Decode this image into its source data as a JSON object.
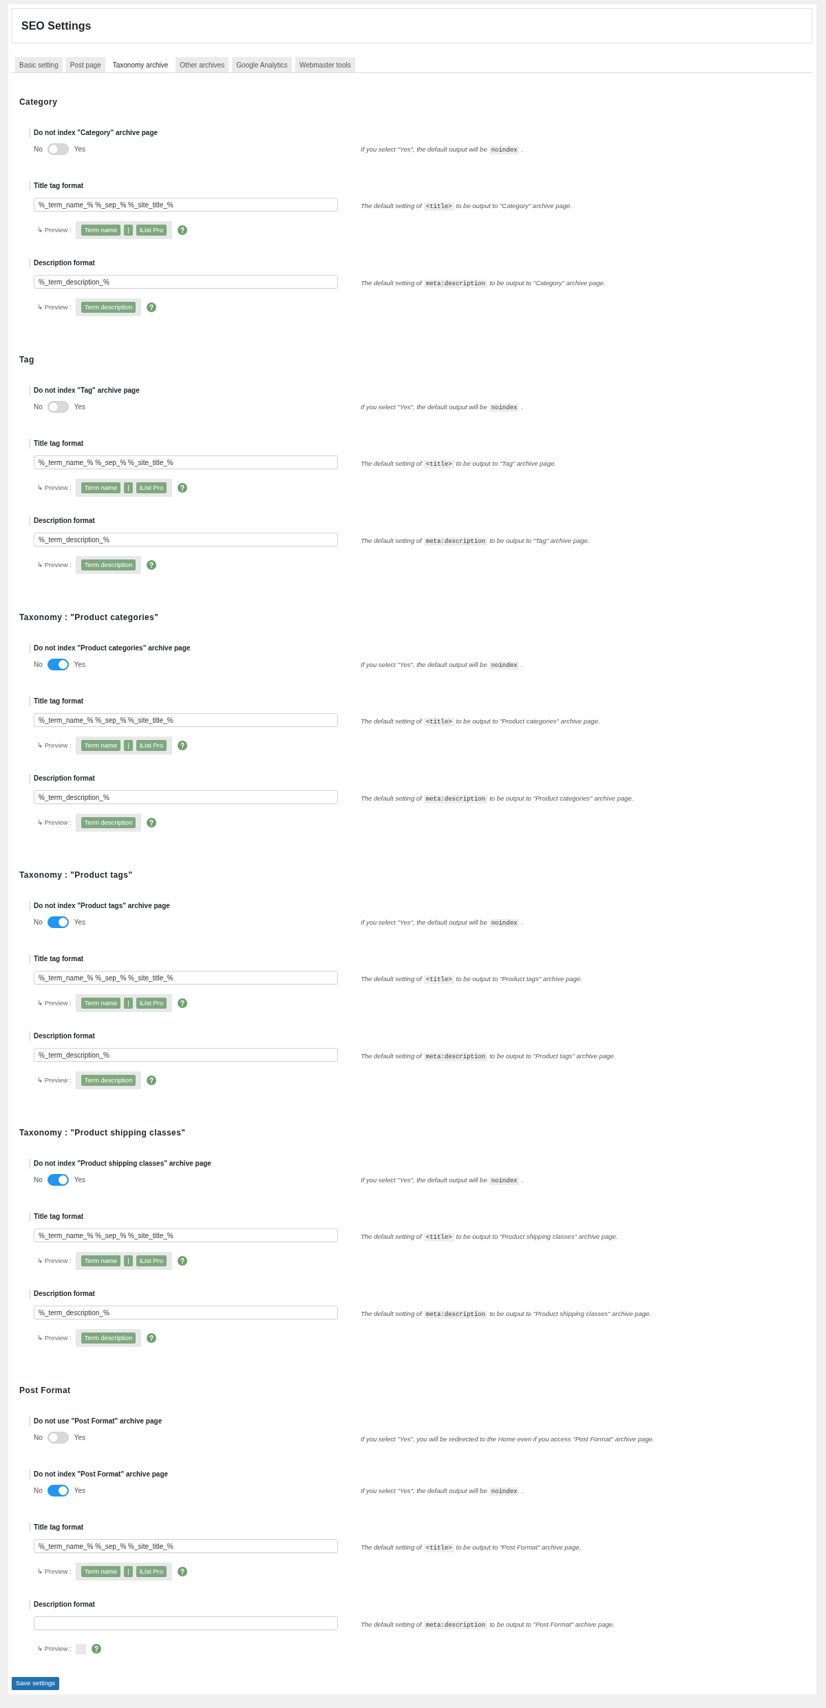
{
  "header": {
    "title": "SEO Settings"
  },
  "tabs": [
    {
      "label": "Basic setting",
      "selected": false
    },
    {
      "label": "Post page",
      "selected": false
    },
    {
      "label": "Taxonomy archive",
      "selected": true
    },
    {
      "label": "Other archives",
      "selected": false
    },
    {
      "label": "Google Analytics",
      "selected": false
    },
    {
      "label": "Webmaster tools",
      "selected": false
    }
  ],
  "sections": [
    {
      "title": "Category",
      "fields": [
        {
          "kind": "toggle",
          "label": "Do not index \"Category\" archive page",
          "off_label": "No",
          "on_label": "Yes",
          "on": false,
          "description": [
            {
              "kind": "text",
              "text": "If you select \"Yes\", the default output will be"
            },
            {
              "kind": "code",
              "text": "noindex"
            },
            {
              "kind": "text",
              "text": "."
            }
          ]
        },
        {
          "kind": "text",
          "label": "Title tag format",
          "value": "%_term_name_% %_sep_% %_site_title_%",
          "preview_label": "↳ Preview :",
          "preview": [
            "Term name",
            "|",
            "iList Pro"
          ],
          "description": [
            {
              "kind": "text",
              "text": "The default setting of"
            },
            {
              "kind": "code",
              "text": "<title>"
            },
            {
              "kind": "text",
              "text": "to be output to \"Category\" archive page."
            }
          ]
        },
        {
          "kind": "text",
          "label": "Description format",
          "value": "%_term_description_%",
          "preview_label": "↳ Preview :",
          "preview": [
            "Term description"
          ],
          "description": [
            {
              "kind": "text",
              "text": "The default setting of"
            },
            {
              "kind": "code",
              "text": "meta:description"
            },
            {
              "kind": "text",
              "text": "to be output to \"Category\" archive page."
            }
          ]
        }
      ]
    },
    {
      "title": "Tag",
      "fields": [
        {
          "kind": "toggle",
          "label": "Do not index \"Tag\" archive page",
          "off_label": "No",
          "on_label": "Yes",
          "on": false,
          "description": [
            {
              "kind": "text",
              "text": "If you select \"Yes\", the default output will be"
            },
            {
              "kind": "code",
              "text": "noindex"
            },
            {
              "kind": "text",
              "text": "."
            }
          ]
        },
        {
          "kind": "text",
          "label": "Title tag format",
          "value": "%_term_name_% %_sep_% %_site_title_%",
          "preview_label": "↳ Preview :",
          "preview": [
            "Term name",
            "|",
            "iList Pro"
          ],
          "description": [
            {
              "kind": "text",
              "text": "The default setting of"
            },
            {
              "kind": "code",
              "text": "<title>"
            },
            {
              "kind": "text",
              "text": "to be output to \"Tag\" archive page."
            }
          ]
        },
        {
          "kind": "text",
          "label": "Description format",
          "value": "%_term_description_%",
          "preview_label": "↳ Preview :",
          "preview": [
            "Term description"
          ],
          "description": [
            {
              "kind": "text",
              "text": "The default setting of"
            },
            {
              "kind": "code",
              "text": "meta:description"
            },
            {
              "kind": "text",
              "text": "to be output to \"Tag\" archive page."
            }
          ]
        }
      ]
    },
    {
      "title": "Taxonomy : \"Product categories\"",
      "fields": [
        {
          "kind": "toggle",
          "label": "Do not index \"Product categories\" archive page",
          "off_label": "No",
          "on_label": "Yes",
          "on": true,
          "description": [
            {
              "kind": "text",
              "text": "If you select \"Yes\", the default output will be"
            },
            {
              "kind": "code",
              "text": "noindex"
            },
            {
              "kind": "text",
              "text": "."
            }
          ]
        },
        {
          "kind": "text",
          "label": "Title tag format",
          "value": "%_term_name_% %_sep_% %_site_title_%",
          "preview_label": "↳ Preview :",
          "preview": [
            "Term name",
            "|",
            "iList Pro"
          ],
          "description": [
            {
              "kind": "text",
              "text": "The default setting of"
            },
            {
              "kind": "code",
              "text": "<title>"
            },
            {
              "kind": "text",
              "text": "to be output to \"Product categories\" archive page."
            }
          ]
        },
        {
          "kind": "text",
          "label": "Description format",
          "value": "%_term_description_%",
          "preview_label": "↳ Preview :",
          "preview": [
            "Term description"
          ],
          "description": [
            {
              "kind": "text",
              "text": "The default setting of"
            },
            {
              "kind": "code",
              "text": "meta:description"
            },
            {
              "kind": "text",
              "text": "to be output to \"Product categories\" archive page."
            }
          ]
        }
      ]
    },
    {
      "title": "Taxonomy : \"Product tags\"",
      "fields": [
        {
          "kind": "toggle",
          "label": "Do not index \"Product tags\" archive page",
          "off_label": "No",
          "on_label": "Yes",
          "on": true,
          "description": [
            {
              "kind": "text",
              "text": "If you select \"Yes\", the default output will be"
            },
            {
              "kind": "code",
              "text": "noindex"
            },
            {
              "kind": "text",
              "text": "."
            }
          ]
        },
        {
          "kind": "text",
          "label": "Title tag format",
          "value": "%_term_name_% %_sep_% %_site_title_%",
          "preview_label": "↳ Preview :",
          "preview": [
            "Term name",
            "|",
            "iList Pro"
          ],
          "description": [
            {
              "kind": "text",
              "text": "The default setting of"
            },
            {
              "kind": "code",
              "text": "<title>"
            },
            {
              "kind": "text",
              "text": "to be output to \"Product tags\" archive page."
            }
          ]
        },
        {
          "kind": "text",
          "label": "Description format",
          "value": "%_term_description_%",
          "preview_label": "↳ Preview :",
          "preview": [
            "Term description"
          ],
          "description": [
            {
              "kind": "text",
              "text": "The default setting of"
            },
            {
              "kind": "code",
              "text": "meta:description"
            },
            {
              "kind": "text",
              "text": "to be output to \"Product tags\" archive page."
            }
          ]
        }
      ]
    },
    {
      "title": "Taxonomy : \"Product shipping classes\"",
      "fields": [
        {
          "kind": "toggle",
          "label": "Do not index \"Product shipping classes\" archive page",
          "off_label": "No",
          "on_label": "Yes",
          "on": true,
          "description": [
            {
              "kind": "text",
              "text": "If you select \"Yes\", the default output will be"
            },
            {
              "kind": "code",
              "text": "noindex"
            },
            {
              "kind": "text",
              "text": "."
            }
          ]
        },
        {
          "kind": "text",
          "label": "Title tag format",
          "value": "%_term_name_% %_sep_% %_site_title_%",
          "preview_label": "↳ Preview :",
          "preview": [
            "Term name",
            "|",
            "iList Pro"
          ],
          "description": [
            {
              "kind": "text",
              "text": "The default setting of"
            },
            {
              "kind": "code",
              "text": "<title>"
            },
            {
              "kind": "text",
              "text": "to be output to \"Product shipping classes\" archive page."
            }
          ]
        },
        {
          "kind": "text",
          "label": "Description format",
          "value": "%_term_description_%",
          "preview_label": "↳ Preview :",
          "preview": [
            "Term description"
          ],
          "description": [
            {
              "kind": "text",
              "text": "The default setting of"
            },
            {
              "kind": "code",
              "text": "meta:description"
            },
            {
              "kind": "text",
              "text": "to be output to \"Product shipping classes\" archive page."
            }
          ]
        }
      ]
    },
    {
      "title": "Post Format",
      "fields": [
        {
          "kind": "toggle",
          "label": "Do not use \"Post Format\" archive page",
          "off_label": "No",
          "on_label": "Yes",
          "on": false,
          "description": [
            {
              "kind": "text",
              "text": "If you select \"Yes\", you will be redirected to the Home even if you access \"Post Format\" archive page."
            }
          ]
        },
        {
          "kind": "toggle",
          "label": "Do not index \"Post Format\" archive page",
          "off_label": "No",
          "on_label": "Yes",
          "on": true,
          "description": [
            {
              "kind": "text",
              "text": "If you select \"Yes\", the default output will be"
            },
            {
              "kind": "code",
              "text": "noindex"
            },
            {
              "kind": "text",
              "text": "."
            }
          ]
        },
        {
          "kind": "text",
          "label": "Title tag format",
          "value": "%_term_name_% %_sep_% %_site_title_%",
          "preview_label": "↳ Preview :",
          "preview": [
            "Term name",
            "|",
            "iList Pro"
          ],
          "description": [
            {
              "kind": "text",
              "text": "The default setting of"
            },
            {
              "kind": "code",
              "text": "<title>"
            },
            {
              "kind": "text",
              "text": "to be output to \"Post Format\" archive page."
            }
          ]
        },
        {
          "kind": "text",
          "label": "Description format",
          "preview_label": "↳ Preview :",
          "description": [
            {
              "kind": "text",
              "text": "The default setting of"
            },
            {
              "kind": "code",
              "text": "meta:description"
            },
            {
              "kind": "text",
              "text": "to be output to \"Post Format\" archive page."
            }
          ]
        }
      ]
    }
  ],
  "save_button": {
    "label": "Save settings"
  }
}
